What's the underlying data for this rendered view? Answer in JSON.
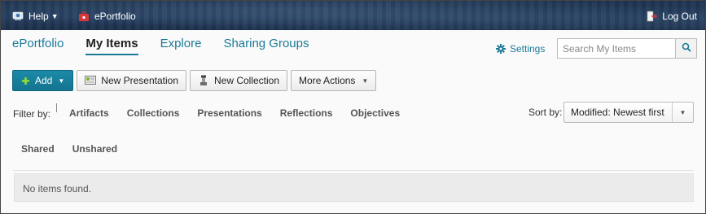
{
  "topbar": {
    "help_label": "Help",
    "eportfolio_label": "ePortfolio",
    "logout_label": "Log Out"
  },
  "nav": {
    "tabs": [
      {
        "label": "ePortfolio"
      },
      {
        "label": "My Items",
        "active": true
      },
      {
        "label": "Explore"
      },
      {
        "label": "Sharing Groups"
      }
    ]
  },
  "settings": {
    "label": "Settings"
  },
  "search": {
    "placeholder": "Search My Items"
  },
  "toolbar": {
    "add_label": "Add",
    "new_presentation_label": "New Presentation",
    "new_collection_label": "New Collection",
    "more_actions_label": "More Actions"
  },
  "filter": {
    "label": "Filter by:",
    "options": [
      "Artifacts",
      "Collections",
      "Presentations",
      "Reflections",
      "Objectives"
    ]
  },
  "sort": {
    "label": "Sort by:",
    "selected": "Modified: Newest first"
  },
  "share_filter": {
    "options": [
      "Shared",
      "Unshared"
    ]
  },
  "results": {
    "empty_message": "No items found."
  },
  "colors": {
    "accent": "#1a7a96",
    "add_button": "#137490",
    "topbar": "#233c5d"
  },
  "icons": {
    "help": "help-icon",
    "eportfolio": "eportfolio-icon",
    "logout": "logout-icon",
    "settings": "gear-icon",
    "search": "search-icon",
    "add": "plus-icon",
    "presentation": "presentation-icon",
    "collection": "collection-icon"
  }
}
